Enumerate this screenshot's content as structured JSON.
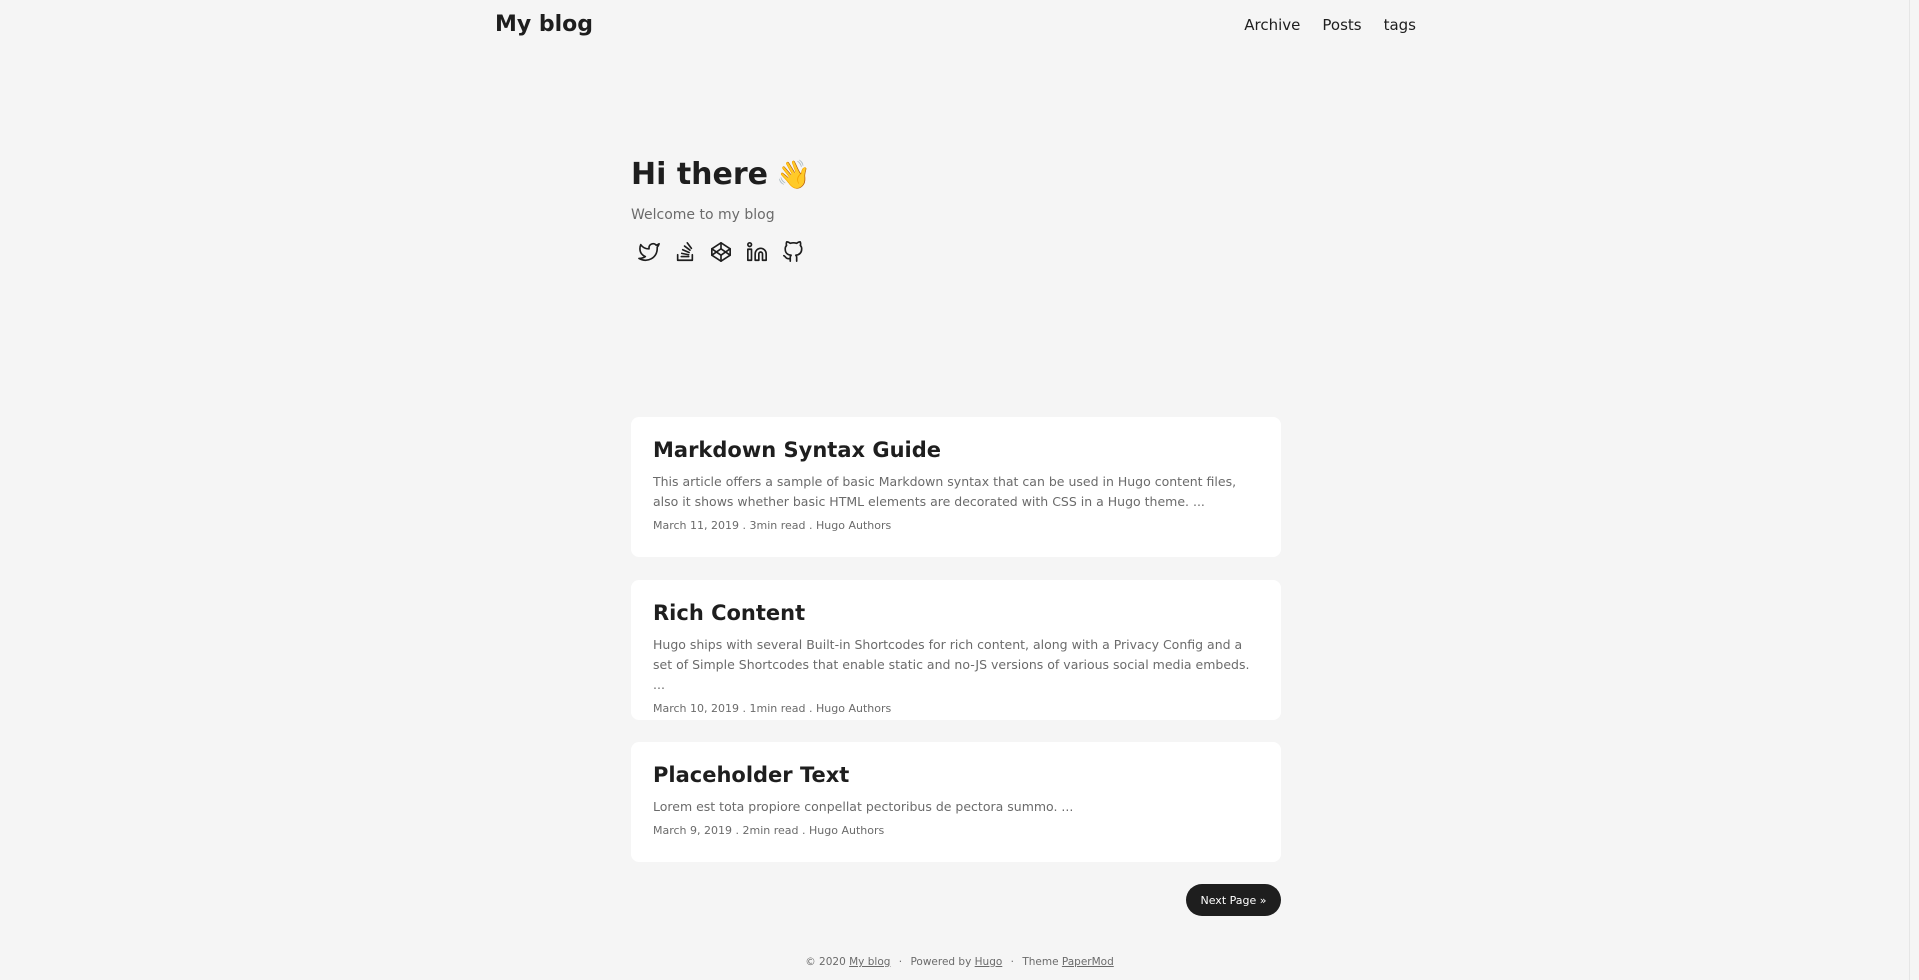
{
  "header": {
    "logo": "My blog",
    "nav": [
      "Archive",
      "Posts",
      "tags"
    ]
  },
  "profile": {
    "title": "Hi there",
    "emoji": "👋",
    "subtitle": "Welcome to my blog",
    "social_icons": [
      "twitter-icon",
      "stackoverflow-icon",
      "codepen-icon",
      "linkedin-icon",
      "github-icon"
    ]
  },
  "posts": [
    {
      "title": "Markdown Syntax Guide",
      "excerpt": "This article offers a sample of basic Markdown syntax that can be used in Hugo content files, also it shows whether basic HTML elements are decorated with CSS in a Hugo theme. ...",
      "meta": "March 11, 2019 . 3min read . Hugo Authors"
    },
    {
      "title": "Rich Content",
      "excerpt": "Hugo ships with several Built-in Shortcodes for rich content, along with a Privacy Config and a set of Simple Shortcodes that enable static and no-JS versions of various social media embeds. ...",
      "meta": "March 10, 2019 . 1min read . Hugo Authors"
    },
    {
      "title": "Placeholder Text",
      "excerpt": "Lorem est tota propiore conpellat pectoribus de pectora summo. ...",
      "meta": "March 9, 2019 . 2min read . Hugo Authors"
    }
  ],
  "pagination": {
    "next_label": "Next Page »"
  },
  "footer": {
    "copyright": "© 2020",
    "site_link": "My blog",
    "sep1": "·",
    "powered_by": "Powered by",
    "hugo_link": "Hugo",
    "sep2": "·",
    "theme_text": "Theme",
    "theme_link": "PaperMod"
  }
}
